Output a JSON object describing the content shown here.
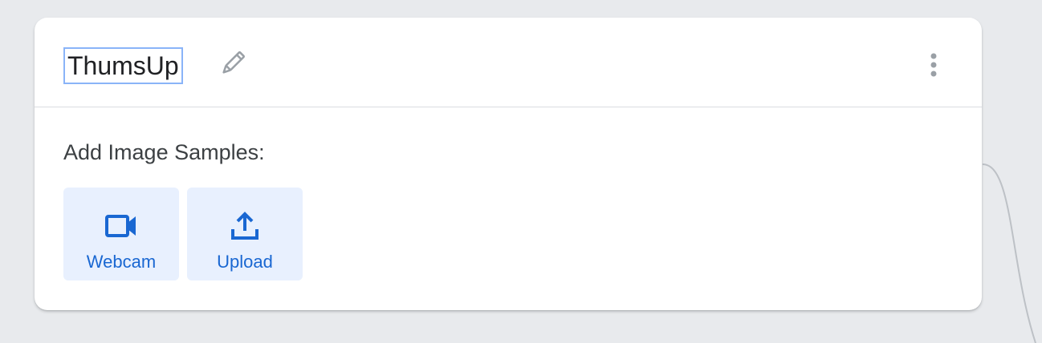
{
  "class_card": {
    "name": "ThumsUp",
    "section_label": "Add Image Samples:",
    "buttons": [
      {
        "label": "Webcam",
        "icon": "videocam-icon"
      },
      {
        "label": "Upload",
        "icon": "upload-icon"
      }
    ]
  },
  "icons": {
    "edit": "pencil-icon",
    "menu": "more-vert-icon"
  },
  "colors": {
    "background": "#e8eaed",
    "card": "#ffffff",
    "accent": "#1967d2",
    "button_bg": "#e8f0fe",
    "name_border": "#8ab4f8"
  }
}
